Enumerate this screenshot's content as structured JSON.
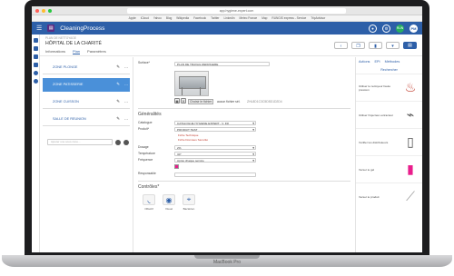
{
  "device": {
    "base_label": "MacBook Pro"
  },
  "browser": {
    "url": "app.hygiene-expert.com",
    "bookmarks": [
      "Apple",
      "iCloud",
      "Yahoo",
      "Blog",
      "Wikipedia",
      "Facebook",
      "Twitter",
      "LinkedIn",
      "Meteo France",
      "Map",
      "RUNGIS express - Service",
      "TripAdvisor"
    ]
  },
  "app": {
    "title": "CleaningProcess",
    "logo_glyph": "▤",
    "header_badge": "RUN",
    "avatar": "PM"
  },
  "page": {
    "breadcrumb": "PLAN DE NETTOYAGE",
    "title": "HÔPITAL DE LA CHARITÉ",
    "tabs": [
      "Informations",
      "Plan",
      "Paramètres"
    ],
    "active_tab": "Plan"
  },
  "zones": {
    "items": [
      {
        "label": "ZONE PLONGE"
      },
      {
        "label": "ZONE PATISSERIE"
      },
      {
        "label": "ZONE CUISSON"
      },
      {
        "label": "SALLE DE REUNION"
      }
    ],
    "add_placeholder": "Ajouter une sous-zone..."
  },
  "form": {
    "surface_label": "Surface*",
    "surface_value": "PLAN DE TRAVAIL REFRIGERE",
    "file_button": "Choisir le fichier",
    "file_status": "aucun fichier sél.",
    "file_name": "ZHL8D1C3C5D5D1D2D4",
    "generalites": "Généralités",
    "catalogue_label": "Catalogue",
    "catalogue_value": "CATALOGUE HYGIENE EXPERT - V. FR",
    "produit_label": "Produit*",
    "produit_value": "PRODUIT TEST",
    "fiche_technique": "Fiche Technique",
    "fiche_securite": "Fiche Données Sécurité",
    "dosage_label": "Dosage",
    "dosage_value": "2%",
    "temperature_label": "Température",
    "temperature_value": "30°",
    "frequence_label": "Fréquence",
    "frequence_value": "Après chaque service",
    "responsable_label": "Responsable",
    "controles": "Contrôles*",
    "controls": [
      {
        "label": "Olfactif"
      },
      {
        "label": "Visuel"
      },
      {
        "label": "Bactérien"
      }
    ]
  },
  "actions": {
    "tabs": [
      "Actions",
      "EPI",
      "Méthodes"
    ],
    "search_label": "Rechercher",
    "items": [
      {
        "label": "Utiliser le nettoyeur haute pression",
        "icon": "nettoyeur-icon"
      },
      {
        "label": "Utiliser l'injecteur-extracteur",
        "icon": "injecteur-icon"
      },
      {
        "label": "Vérifier les distributeurs",
        "icon": "distributeur-icon"
      },
      {
        "label": "Verser le gel",
        "icon": "gel-icon"
      },
      {
        "label": "Verser le produit",
        "icon": "produit-icon"
      }
    ]
  },
  "colors": {
    "header": "#2d5fa8",
    "active_zone": "#4a90d9",
    "brand": "#5b2c83"
  }
}
